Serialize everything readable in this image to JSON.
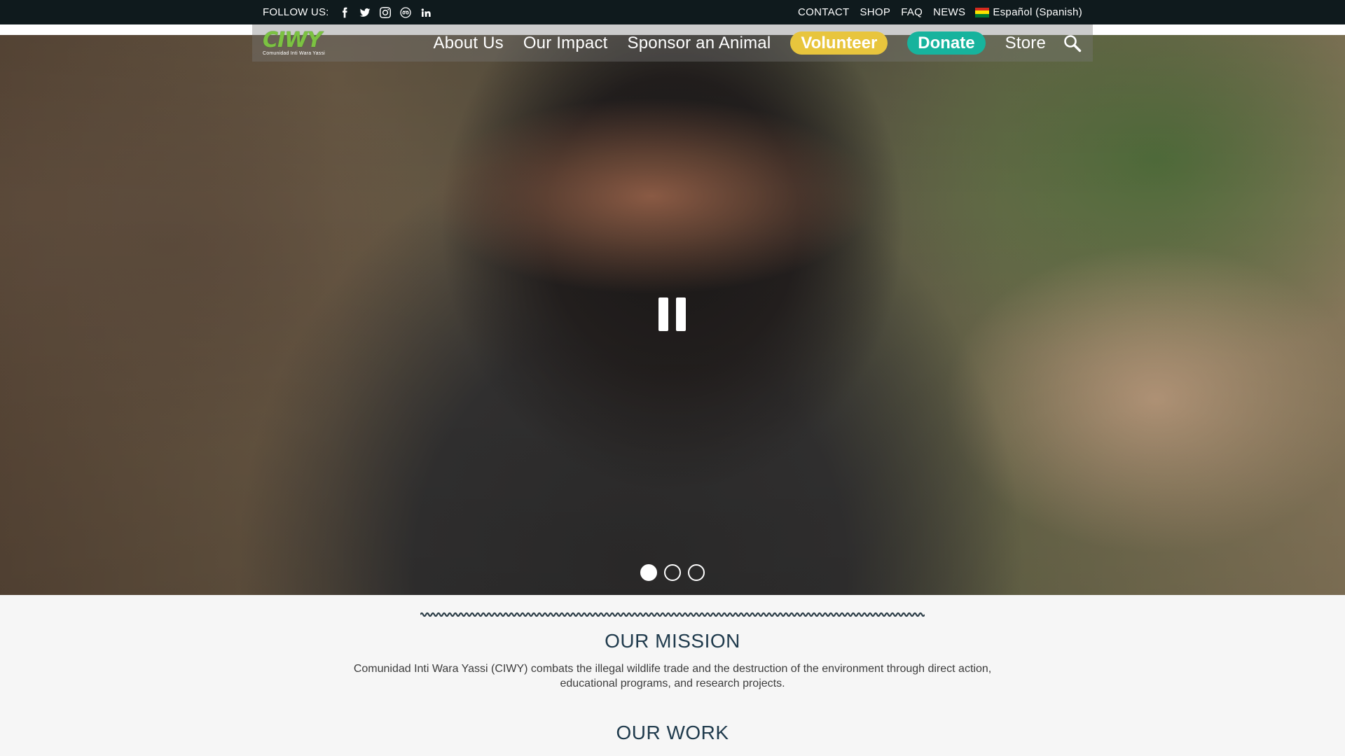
{
  "topbar": {
    "follow_label": "FOLLOW US:",
    "social": [
      "facebook-icon",
      "twitter-icon",
      "instagram-icon",
      "tripadvisor-icon",
      "linkedin-icon"
    ],
    "links": [
      "CONTACT",
      "SHOP",
      "FAQ",
      "NEWS"
    ],
    "language": "Español (Spanish)",
    "flag_colors": [
      "#d52b1e",
      "#f9e300",
      "#007934"
    ]
  },
  "nav": {
    "logo_word": "CIWY",
    "logo_sub": "Comunidad Inti Wara Yassi",
    "items": [
      "About Us",
      "Our Impact",
      "Sponsor an Animal"
    ],
    "volunteer": "Volunteer",
    "donate": "Donate",
    "store": "Store",
    "colors": {
      "volunteer": "#e8c53d",
      "donate": "#17b39d"
    }
  },
  "hero": {
    "slides": 3,
    "active_slide": 1
  },
  "mission": {
    "title": "OUR MISSION",
    "text": "Comunidad Inti Wara Yassi (CIWY) combats the illegal wildlife trade and the destruction of the environment through direct action, educational programs, and research projects."
  },
  "work": {
    "title": "OUR WORK"
  }
}
